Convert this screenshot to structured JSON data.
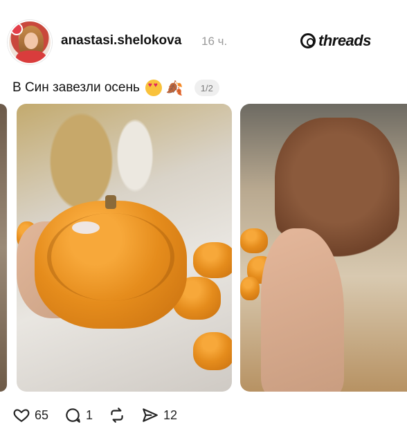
{
  "post": {
    "username": "anastasi.shelokova",
    "time": "16 ч.",
    "caption": "В Син завезли осень",
    "emoji_reactions": [
      "heart-eyes-emoji",
      "fallen-leaves-emoji"
    ],
    "page_indicator": "1/2"
  },
  "brand": {
    "name": "threads"
  },
  "carousel": {
    "images": [
      {
        "name": "previous-photo",
        "icon": "photo"
      },
      {
        "name": "pumpkin-jar-photo",
        "icon": "photo"
      },
      {
        "name": "plush-toy-photo",
        "icon": "photo"
      }
    ]
  },
  "actions": {
    "likes": "65",
    "comments": "1",
    "shares": "12",
    "icons": {
      "like": "heart-icon",
      "comment": "comment-icon",
      "repost": "repost-icon",
      "share": "send-icon"
    }
  },
  "colors": {
    "text_primary": "#101010",
    "text_secondary": "#9a9a9a",
    "pill_bg": "#efefef",
    "pumpkin_orange": "#e58c1c"
  }
}
